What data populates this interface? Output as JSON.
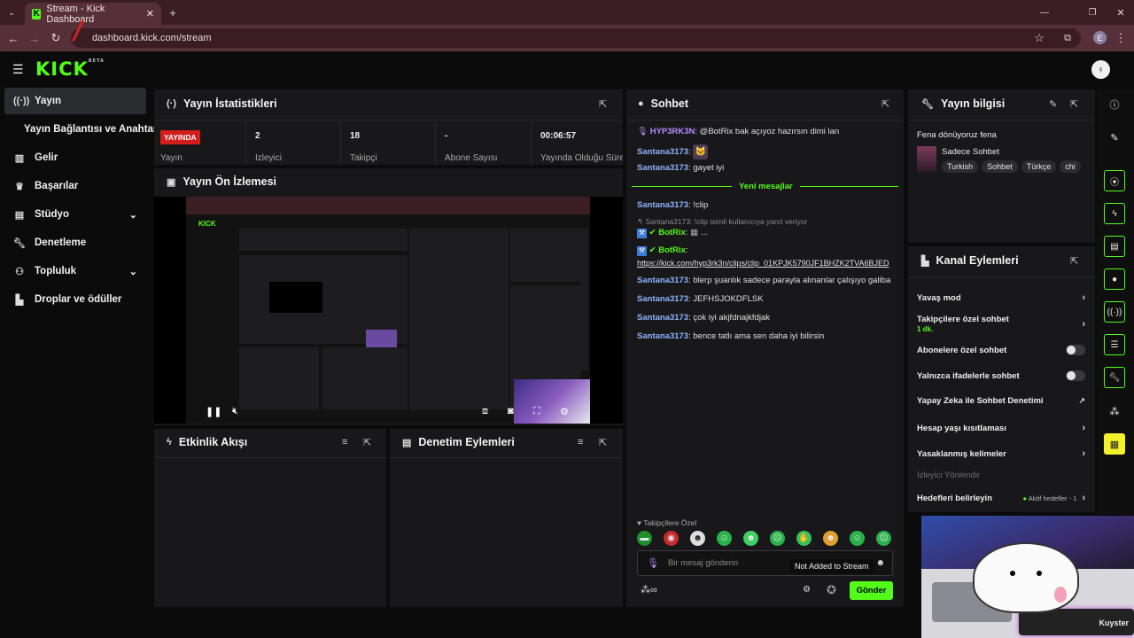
{
  "browser": {
    "tab_title": "Stream - Kick Dashboard",
    "url": "dashboard.kick.com/stream",
    "profile_letter": "E"
  },
  "app": {
    "logo": "KICK",
    "logo_badge": "BETA"
  },
  "sidebar": {
    "items": [
      {
        "label": "Yayın",
        "icon": "broadcast-icon",
        "active": true
      },
      {
        "label": "Yayın Bağlantısı ve Anahtarı",
        "icon": "",
        "active": false
      },
      {
        "label": "Gelir",
        "icon": "chart-icon",
        "active": false
      },
      {
        "label": "Başarılar",
        "icon": "trophy-icon",
        "active": false
      },
      {
        "label": "Stüdyo",
        "icon": "studio-icon",
        "active": false,
        "chevron": true
      },
      {
        "label": "Denetleme",
        "icon": "wrench-icon",
        "active": false
      },
      {
        "label": "Topluluk",
        "icon": "community-icon",
        "active": false,
        "chevron": true
      },
      {
        "label": "Droplar ve ödüller",
        "icon": "drops-icon",
        "active": false
      }
    ]
  },
  "stats": {
    "title": "Yayın İstatistikleri",
    "live_badge": "YAYINDA",
    "items": [
      {
        "label": "Yayın",
        "value": ""
      },
      {
        "label": "İzleyici",
        "value": "2"
      },
      {
        "label": "Takipçi",
        "value": "18"
      },
      {
        "label": "Abone Sayısı",
        "value": "-"
      },
      {
        "label": "Yayında Olduğu Süre",
        "value": "00:06:57"
      }
    ]
  },
  "preview": {
    "title": "Yayın Ön İzlemesi",
    "tooltip": "Not Added to Stream"
  },
  "activity": {
    "title": "Etkinlik Akışı"
  },
  "mod_actions": {
    "title": "Denetim Eylemleri"
  },
  "chat": {
    "title": "Sohbet",
    "new_messages": "Yeni mesajlar",
    "messages": [
      {
        "user": "HYP3RK3N",
        "text": "@BotRix bak açıyoz hazırsın dimi lan",
        "color": "#b48aff"
      },
      {
        "user": "Santana3173",
        "text": "",
        "color": "#8fb4ff"
      },
      {
        "user": "Santana3173",
        "text": "gayet iyi",
        "color": "#8fb4ff"
      },
      {
        "user": "Santana3173",
        "text": "!clip",
        "color": "#8fb4ff"
      },
      {
        "user": "BotRix",
        "text": "...",
        "color": "#53fc18"
      },
      {
        "user": "BotRix",
        "text": "https://kick.com/hyp3rk3n/clips/clip_01KPJK5790JF1BHZK2TVA6BJED",
        "color": "#53fc18"
      },
      {
        "user": "Santana3173",
        "text": "blerp şuanlık sadece parayla alınanlar çalışıyo galiba",
        "color": "#8fb4ff"
      },
      {
        "user": "Santana3173",
        "text": "JEFHSJOKDFLSK",
        "color": "#8fb4ff"
      },
      {
        "user": "Santana3173",
        "text": "çok iyi akjfdnajkfdjak",
        "color": "#8fb4ff"
      },
      {
        "user": "Santana3173",
        "text": "bence tatlı ama sen daha iyi bilirsin",
        "color": "#8fb4ff"
      }
    ],
    "reply_note": "Santana3173: !clip isimli kullanıcıya yanıt veriyor",
    "followers_only": "Takipçilere Özel",
    "input_placeholder": "Bir mesaj gönderin",
    "send_label": "Gönder"
  },
  "stream_info": {
    "title": "Yayın bilgisi",
    "stream_title": "Fena dönüyoruz fena",
    "category": "Sadece Sohbet",
    "tags": [
      "Turkish",
      "Sohbet",
      "Türkçe",
      "chi"
    ]
  },
  "channel_actions": {
    "title": "Kanal Eylemleri",
    "items": [
      {
        "label": "Yavaş mod",
        "control": "arrow"
      },
      {
        "label": "Takipçilere özel sohbet",
        "sub": "1 dk.",
        "control": "arrow"
      },
      {
        "label": "Abonelere özel sohbet",
        "control": "toggle"
      },
      {
        "label": "Yalnızca ifadelerle sohbet",
        "control": "toggle"
      },
      {
        "label": "Yapay Zeka ile Sohbet Denetimi",
        "control": "external"
      },
      {
        "label": "Hesap yaşı kısıtlaması",
        "control": "arrow"
      },
      {
        "label": "Yasaklanmış kelimeler",
        "control": "arrow"
      },
      {
        "label": "İzleyici Yönlendir",
        "control": "none"
      },
      {
        "label": "Hedefleri belirleyin",
        "control": "arrow",
        "badge": "Aktif hedefler - 1"
      }
    ]
  },
  "webcam": {
    "watermark": "Kuyster"
  }
}
